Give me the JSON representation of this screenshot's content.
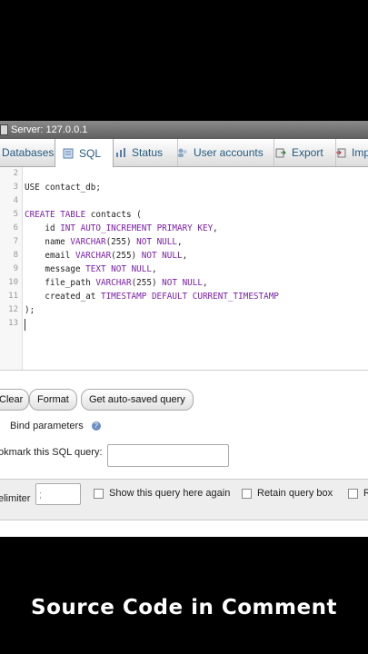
{
  "server": {
    "title": "Server: 127.0.0.1"
  },
  "tabs": [
    {
      "label": "Databases",
      "icon": "database-icon"
    },
    {
      "label": "SQL",
      "icon": "sql-icon"
    },
    {
      "label": "Status",
      "icon": "status-icon"
    },
    {
      "label": "User accounts",
      "icon": "users-icon"
    },
    {
      "label": "Export",
      "icon": "export-icon"
    },
    {
      "label": "Imp",
      "icon": "import-icon"
    }
  ],
  "editor": {
    "line_numbers": [
      "2",
      "3",
      "4",
      "5",
      "6",
      "7",
      "8",
      "9",
      "10",
      "11",
      "12",
      "13"
    ],
    "lines": [
      "",
      "USE contact_db;",
      "",
      "CREATE TABLE contacts (",
      "    id INT AUTO_INCREMENT PRIMARY KEY,",
      "    name VARCHAR(255) NOT NULL,",
      "    email VARCHAR(255) NOT NULL,",
      "    message TEXT NOT NULL,",
      "    file_path VARCHAR(255) NOT NULL,",
      "    created_at TIMESTAMP DEFAULT CURRENT_TIMESTAMP",
      ");",
      ""
    ]
  },
  "buttons": {
    "clear": "Clear",
    "format": "Format",
    "autosaved": "Get auto-saved query"
  },
  "bind_parameters": "Bind parameters",
  "bookmark": {
    "label": "okmark this SQL query:",
    "value": ""
  },
  "options": {
    "delimiter_label": "elimiter",
    "delimiter_value": ";",
    "show_query": "Show this query here again",
    "retain_query": "Retain query box",
    "cut": "R"
  },
  "overlay_caption": "Source Code in Comment",
  "colors": {
    "keyword": "#7a1fa8",
    "tab_text": "#235a81",
    "server_bar": "#6f6f6f"
  }
}
